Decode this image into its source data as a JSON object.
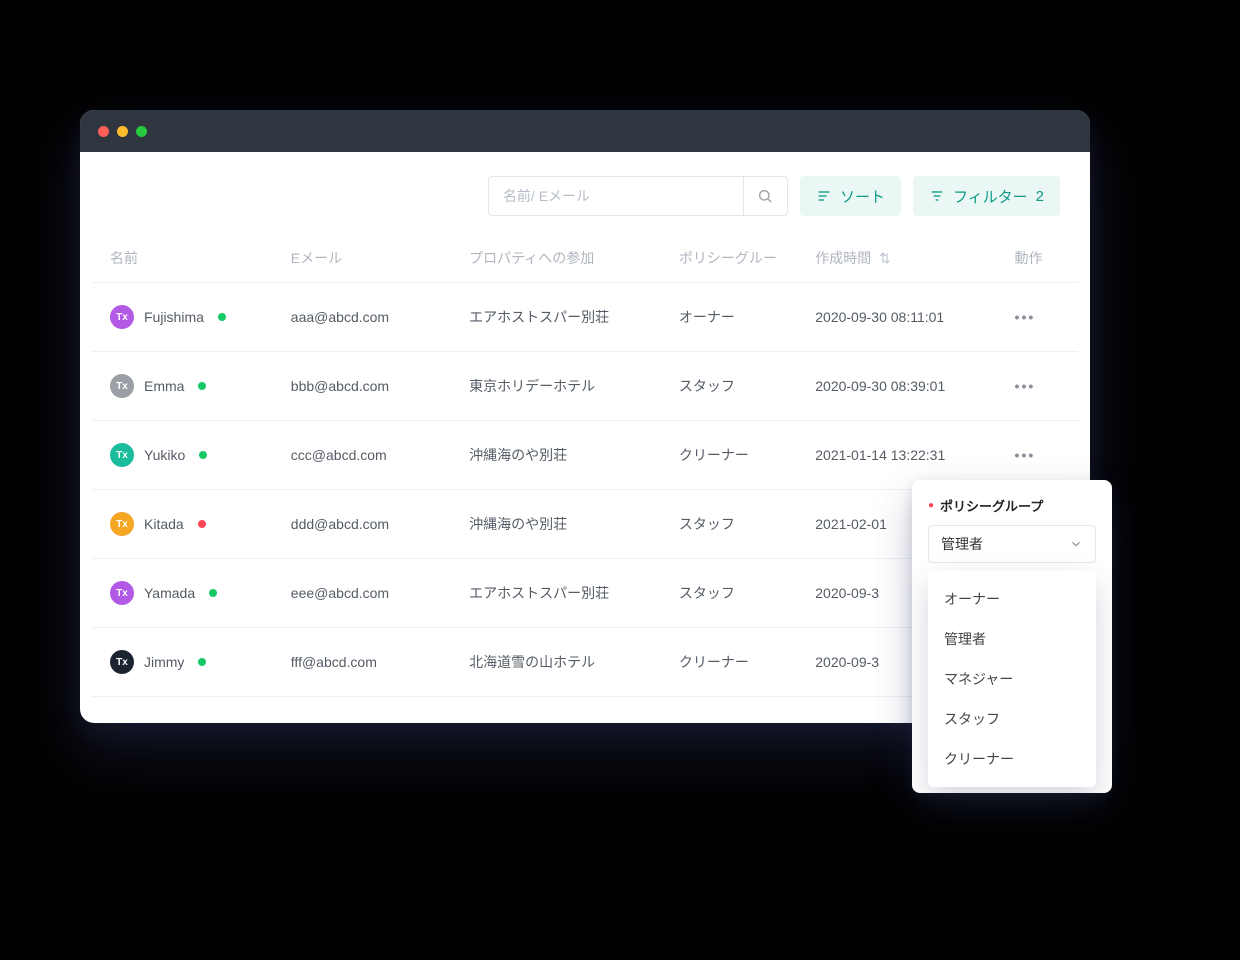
{
  "search": {
    "placeholder": "名前/ Eメール"
  },
  "toolbar": {
    "sort_label": "ソート",
    "filter_label": "フィルター",
    "filter_count": "2"
  },
  "columns": {
    "name": "名前",
    "email": "Eメール",
    "property": "プロパティへの参加",
    "policy": "ポリシーグルー",
    "created": "作成時間",
    "action": "動作"
  },
  "rows": [
    {
      "avatar_label": "Tx",
      "avatar_color": "#b25ae6",
      "name": "Fujishima",
      "status": "green",
      "email": "aaa@abcd.com",
      "property": "エアホストスパー別荘",
      "policy": "オーナー",
      "created": "2020-09-30 08:11:01"
    },
    {
      "avatar_label": "Tx",
      "avatar_color": "#9aa0a6",
      "name": "Emma",
      "status": "green",
      "email": "bbb@abcd.com",
      "property": "東京ホリデーホテル",
      "policy": "スタッフ",
      "created": "2020-09-30 08:39:01"
    },
    {
      "avatar_label": "Tx",
      "avatar_color": "#1abc9c",
      "name": "Yukiko",
      "status": "green",
      "email": "ccc@abcd.com",
      "property": "沖縄海のや別荘",
      "policy": "クリーナー",
      "created": "2021-01-14 13:22:31"
    },
    {
      "avatar_label": "Tx",
      "avatar_color": "#f5a623",
      "name": "Kitada",
      "status": "red",
      "email": "ddd@abcd.com",
      "property": "沖縄海のや別荘",
      "policy": "スタッフ",
      "created": "2021-02-01"
    },
    {
      "avatar_label": "Tx",
      "avatar_color": "#b25ae6",
      "name": "Yamada",
      "status": "green",
      "email": "eee@abcd.com",
      "property": "エアホストスパー別荘",
      "policy": "スタッフ",
      "created": "2020-09-3"
    },
    {
      "avatar_label": "Tx",
      "avatar_color": "#1b2430",
      "name": "Jimmy",
      "status": "green",
      "email": "fff@abcd.com",
      "property": "北海道雪の山ホテル",
      "policy": "クリーナー",
      "created": "2020-09-3"
    }
  ],
  "popover": {
    "label": "ポリシーグループ",
    "selected": "管理者",
    "options": [
      "オーナー",
      "管理者",
      "マネジャー",
      "スタッフ",
      "クリーナー"
    ]
  }
}
